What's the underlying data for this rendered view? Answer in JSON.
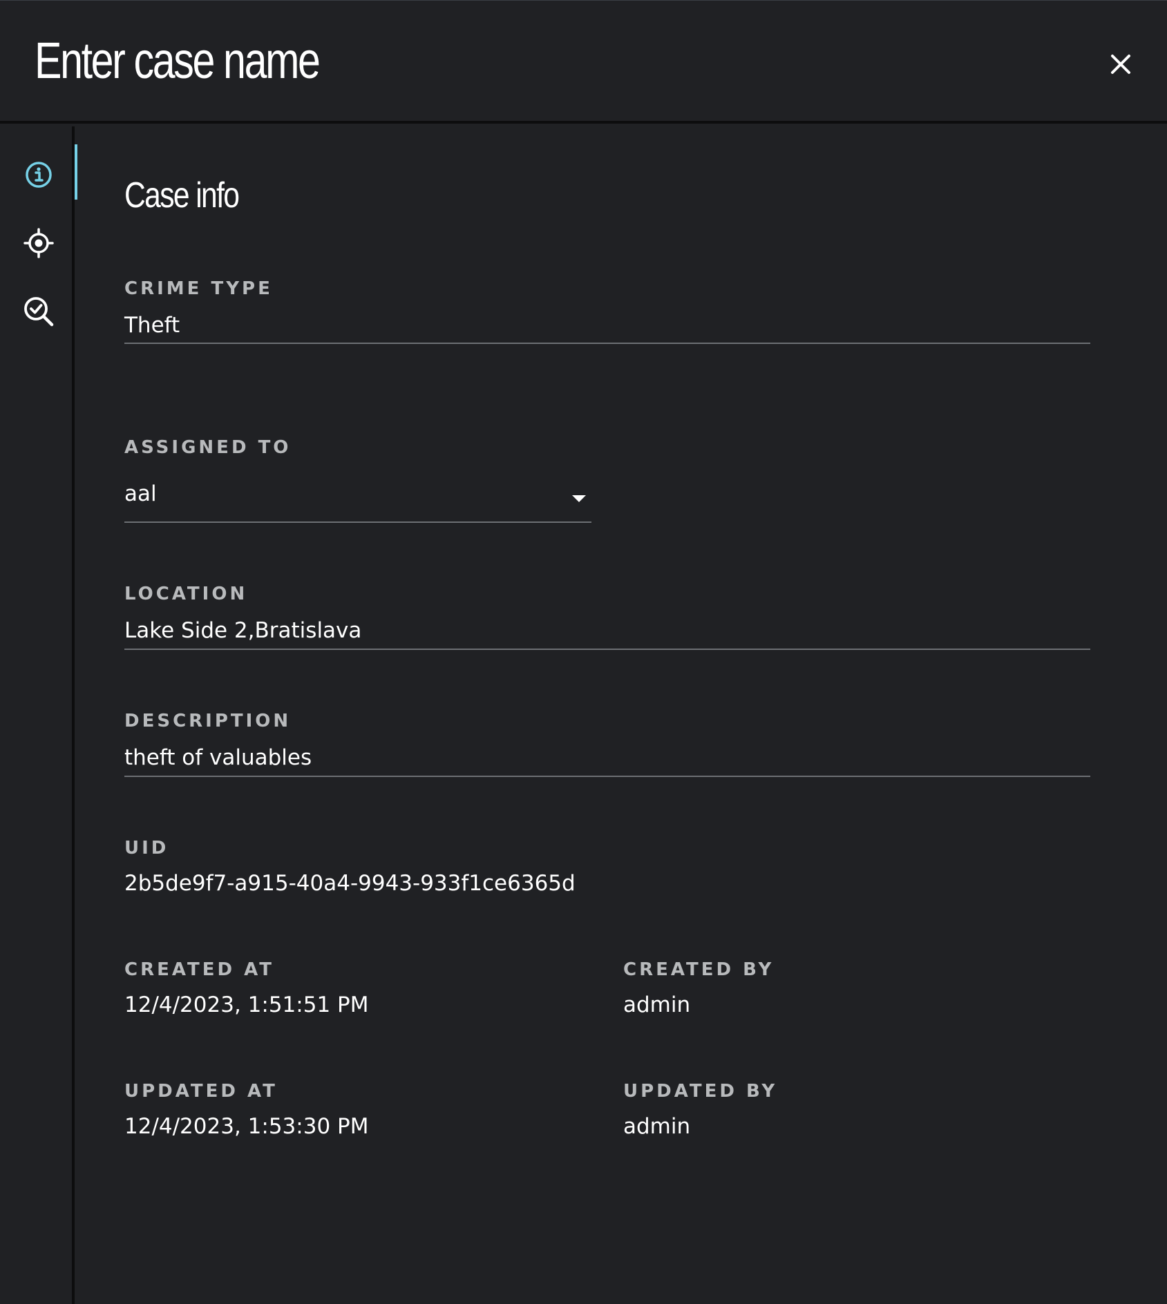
{
  "dialog": {
    "title": "Enter case name"
  },
  "sidebar": {
    "items": [
      {
        "name": "info",
        "icon": "info-icon",
        "active": true
      },
      {
        "name": "location",
        "icon": "target-icon",
        "active": false
      },
      {
        "name": "review",
        "icon": "search-check-icon",
        "active": false
      }
    ],
    "accent_color": "#76d1e7"
  },
  "case_info": {
    "section_title": "Case info",
    "crime_type": {
      "label": "CRIME TYPE",
      "value": "Theft"
    },
    "assigned_to": {
      "label": "ASSIGNED TO",
      "value": "aal"
    },
    "location": {
      "label": "LOCATION",
      "value": "Lake Side 2,Bratislava"
    },
    "description": {
      "label": "DESCRIPTION",
      "value": "theft of valuables"
    },
    "uid": {
      "label": "UID",
      "value": "2b5de9f7-a915-40a4-9943-933f1ce6365d"
    },
    "created_at": {
      "label": "CREATED AT",
      "value": "12/4/2023, 1:51:51 PM"
    },
    "created_by": {
      "label": "CREATED BY",
      "value": "admin"
    },
    "updated_at": {
      "label": "UPDATED AT",
      "value": "12/4/2023, 1:53:30 PM"
    },
    "updated_by": {
      "label": "UPDATED BY",
      "value": "admin"
    }
  },
  "colors": {
    "background": "#202124",
    "divider": "#0d0d0e",
    "label": "#b8babc",
    "underline": "#6d7074"
  }
}
